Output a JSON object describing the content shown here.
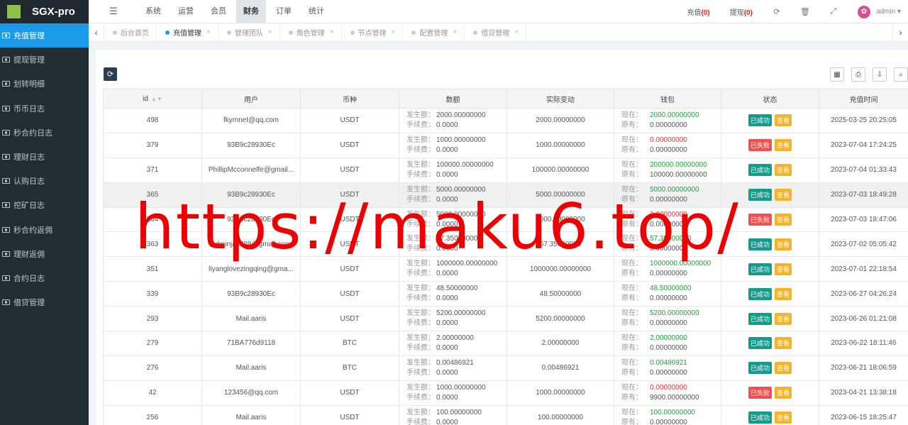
{
  "brand": {
    "title": "SGX-pro"
  },
  "sidebar": {
    "items": [
      {
        "label": "充值管理",
        "active": true
      },
      {
        "label": "提现管理"
      },
      {
        "label": "划转明细"
      },
      {
        "label": "币币日志"
      },
      {
        "label": "秒合约日志"
      },
      {
        "label": "理财日志"
      },
      {
        "label": "认购日志"
      },
      {
        "label": "挖矿日志"
      },
      {
        "label": "秒合约返佣"
      },
      {
        "label": "理财返佣"
      },
      {
        "label": "合约日志"
      },
      {
        "label": "借贷管理"
      }
    ]
  },
  "header": {
    "menu_icon": "menu-icon",
    "nav": [
      {
        "label": "系统"
      },
      {
        "label": "运营"
      },
      {
        "label": "会员"
      },
      {
        "label": "财务",
        "active": true
      },
      {
        "label": "订单"
      },
      {
        "label": "统计"
      }
    ],
    "recharge_label": "充值",
    "recharge_count": "(0)",
    "withdraw_label": "提现",
    "withdraw_count": "(0)",
    "icons": [
      "refresh-icon",
      "trash-icon",
      "fullscreen-icon"
    ],
    "user": "admin"
  },
  "tabs": [
    {
      "label": "后台首页"
    },
    {
      "label": "充值管理",
      "active": true
    },
    {
      "label": "管理团队"
    },
    {
      "label": "角色管理"
    },
    {
      "label": "节点管理"
    },
    {
      "label": "配置管理"
    },
    {
      "label": "借贷管理"
    }
  ],
  "table": {
    "columns": [
      "id",
      "用户",
      "币种",
      "数额",
      "实际变动",
      "钱包",
      "状态",
      "充值时间"
    ],
    "amount_labels": {
      "occur": "发生额：",
      "fee": "手续费："
    },
    "wallet_labels": {
      "now": "现在：",
      "before": "原有："
    },
    "status_ok": "已成功",
    "status_fail": "已失败",
    "view_label": "查看",
    "rows": [
      {
        "id": "498",
        "user": "fkymnet@qq.com",
        "coin": "USDT",
        "occur": "2000.00000000",
        "fee": "0.0000",
        "change": "2000.00000000",
        "now": "2000.00000000",
        "before": "0.00000000",
        "status": "ok",
        "time": "2025-03-25 20:25:05"
      },
      {
        "id": "379",
        "user": "93B9c28930Ec",
        "coin": "USDT",
        "occur": "1000.00000000",
        "fee": "0.0000",
        "change": "1000.00000000",
        "now": "0.00000000",
        "before": "0.00000000",
        "status": "fail",
        "time": "2023-07-04 17:24:25"
      },
      {
        "id": "371",
        "user": "PhillipMcconnelfe@gmail...",
        "coin": "USDT",
        "occur": "100000.00000000",
        "fee": "0.0000",
        "change": "100000.00000000",
        "now": "200000.00000000",
        "before": "100000.00000000",
        "status": "ok",
        "time": "2023-07-04 01:33:43"
      },
      {
        "id": "365",
        "user": "93B9c28930Ec",
        "coin": "USDT",
        "occur": "5000.00000000",
        "fee": "0.0000",
        "change": "5000.00000000",
        "now": "5000.00000000",
        "before": "0.00000000",
        "status": "ok",
        "time": "2023-07-03 18:49:28"
      },
      {
        "id": "364",
        "user": "93B9c28930Ec",
        "coin": "USDT",
        "occur": "5000.00000000",
        "fee": "0.0000",
        "change": "5000.00000000",
        "now": "0.00000000",
        "before": "0.00000000",
        "status": "fail",
        "time": "2023-07-03 18:47:06"
      },
      {
        "id": "363",
        "user": "adminjas388@gmail.com",
        "coin": "USDT",
        "occur": "57.35000000",
        "fee": "0.0000",
        "change": "57.35000000",
        "now": "57.35000000",
        "before": "0.00000000",
        "status": "ok",
        "time": "2023-07-02 05:05:42"
      },
      {
        "id": "351",
        "user": "liyanglovezingqing@gma...",
        "coin": "USDT",
        "occur": "1000000.00000000",
        "fee": "0.0000",
        "change": "1000000.00000000",
        "now": "1000000.00000000",
        "before": "0.00000000",
        "status": "ok",
        "time": "2023-07-01 22:18:54"
      },
      {
        "id": "339",
        "user": "93B9c28930Ec",
        "coin": "USDT",
        "occur": "48.50000000",
        "fee": "0.0000",
        "change": "48.50000000",
        "now": "48.50000000",
        "before": "0.00000000",
        "status": "ok",
        "time": "2023-06-27 04:26:24"
      },
      {
        "id": "293",
        "user": "Mail.aaris",
        "coin": "USDT",
        "occur": "5200.00000000",
        "fee": "0.0000",
        "change": "5200.00000000",
        "now": "5200.00000000",
        "before": "0.00000000",
        "status": "ok",
        "time": "2023-06-26 01:21:08"
      },
      {
        "id": "279",
        "user": "71BA776d9118",
        "coin": "BTC",
        "occur": "2.00000000",
        "fee": "0.0000",
        "change": "2.00000000",
        "now": "2.00000000",
        "before": "0.00000000",
        "status": "ok",
        "time": "2023-06-22 18:11:46"
      },
      {
        "id": "276",
        "user": "Mail.aaris",
        "coin": "BTC",
        "occur": "0.00486921",
        "fee": "0.0000",
        "change": "0.00486921",
        "now": "0.00486921",
        "before": "0.00000000",
        "status": "ok",
        "time": "2023-06-21 18:06:59"
      },
      {
        "id": "42",
        "user": "123456@qq.com",
        "coin": "USDT",
        "occur": "1000.00000000",
        "fee": "0.0000",
        "change": "1000.00000000",
        "now": "0.00000000",
        "before": "9900.00000000",
        "status": "fail",
        "time": "2023-04-21 13:38:18"
      },
      {
        "id": "256",
        "user": "Mail.aaris",
        "coin": "USDT",
        "occur": "100.00000000",
        "fee": "0.0000",
        "change": "100.00000000",
        "now": "100.00000000",
        "before": "0.00000000",
        "status": "ok",
        "time": "2023-06-15 18:25:47"
      }
    ]
  },
  "watermark": "https://maku6.top/"
}
